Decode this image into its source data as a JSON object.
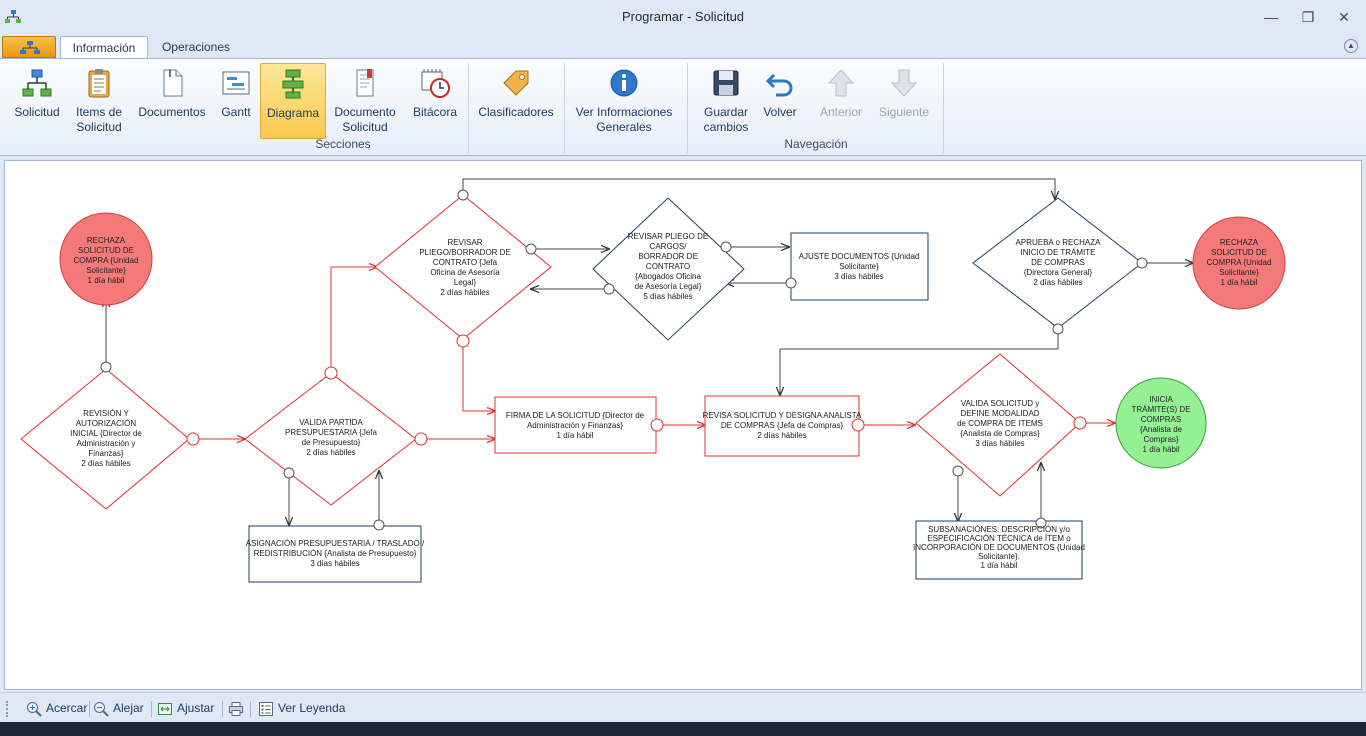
{
  "window": {
    "title": "Programar - Solicitud",
    "controls": {
      "minimize": "—",
      "restore": "❐",
      "close": "✕"
    }
  },
  "tabs": [
    {
      "label": "Información",
      "active": true
    },
    {
      "label": "Operaciones",
      "active": false
    }
  ],
  "ribbon": {
    "secciones": {
      "label": "Secciones",
      "buttons": [
        {
          "label_1": "Solicitud",
          "label_2": ""
        },
        {
          "label_1": "Items de",
          "label_2": "Solicitud"
        },
        {
          "label_1": "Documentos",
          "label_2": ""
        },
        {
          "label_1": "Gantt",
          "label_2": ""
        },
        {
          "label_1": "Diagrama",
          "label_2": "",
          "selected": true
        },
        {
          "label_1": "Documento",
          "label_2": "Solicitud"
        },
        {
          "label_1": "Bitácora",
          "label_2": ""
        },
        {
          "label_1": "Clasificadores",
          "label_2": ""
        },
        {
          "label_1": "Ver Informaciones",
          "label_2": "Generales"
        }
      ]
    },
    "navegacion": {
      "label": "Navegación",
      "buttons": [
        {
          "label_1": "Guardar",
          "label_2": "cambios"
        },
        {
          "label_1": "Volver",
          "label_2": ""
        },
        {
          "label_1": "Anterior",
          "label_2": "",
          "disabled": true
        },
        {
          "label_1": "Siguiente",
          "label_2": "",
          "disabled": true
        }
      ]
    }
  },
  "diagram": {
    "colors": {
      "red": "#e03030",
      "blue": "#1f3f66",
      "reject_fill": "#f47a7a",
      "start_fill": "#93f093"
    },
    "nodes": {
      "rechaza_left": [
        "RECHAZA",
        "SOLICITUD DE",
        "COMPRA {Unidad",
        "Solicitante}",
        "1 día hábil"
      ],
      "revision": [
        "REVISIÓN Y",
        "AUTORIZACIÓN",
        "INICIAL {Director de",
        "Administración y",
        "Finanzas}",
        "2 días hábiles"
      ],
      "valida_partida": [
        "VALIDA PARTIDA",
        "PRESUPUESTARIA {Jefa",
        "de  Presupuesto}",
        "2 días hábiles"
      ],
      "asignacion": [
        "ASIGNACIÓN PRESUPUESTARIA / TRASLADO /",
        "REDISTRIBUCIÓN {Analista de Presupuesto}",
        "3 días hábiles"
      ],
      "revisar_pliego_borrador": [
        "REVISAR",
        "PLIEGO/BORRADOR DE",
        "CONTRATO  {Jefa",
        "Oficina de Asesoría",
        "Legal}",
        "2 días hábiles"
      ],
      "revisar_pliego_cargos": [
        "REVISAR PLIEGO DE",
        "CARGOS/",
        "BORRADOR DE",
        "CONTRATO",
        "{Abogados Oficina",
        "de Asesoría Legal}",
        "5 días hábiles"
      ],
      "ajuste_documentos": [
        "AJUSTE DOCUMENTOS {Unidad",
        "Solicitante}",
        "3 días hábiles"
      ],
      "firma": [
        "FIRMA DE LA SOLICITUD {Director de",
        "Administración y Finanzas}",
        "1 día hábil"
      ],
      "revisa_designa": [
        "REVISA SOLICITUD Y DESIGNA ANALISTA",
        "DE COMPRAS {Jefa de Compras}",
        "2 días hábiles"
      ],
      "aprueba_rechaza": [
        "APRUEBA o RECHAZA",
        "INICIO DE TRÁMITE",
        "DE COMPRAS",
        "{Directora General}",
        "2 días hábiles"
      ],
      "rechaza_right": [
        "RECHAZA",
        "SOLICITUD DE",
        "COMPRA {Unidad",
        "Solicitante}",
        "1 día hábil"
      ],
      "valida_solicitud": [
        "VALIDA SOLICITUD y",
        "DEFINE MODALIDAD",
        "de COMPRA DE ITEMS",
        "{Analista de Compras}",
        "3 días hábiles"
      ],
      "subsanaciones": [
        "SUBSANACIÓNES: DESCRIPCIÓN y/o",
        "ESPECIFICACIÓN TÉCNICA de ÍTEM o",
        "INCORPORACIÓN DE DOCUMENTOS {Unidad",
        "Solicitante}.",
        "1 día hábil"
      ],
      "inicia_tramite": [
        "INICIA",
        "TRÁMITE(S) DE",
        "COMPRAS",
        "{Analista de",
        "Compras}",
        "1 día hábil"
      ]
    }
  },
  "bottombar": {
    "zoom_in": "Acercar",
    "zoom_out": "Alejar",
    "fit": "Ajustar",
    "legend": "Ver Leyenda"
  }
}
